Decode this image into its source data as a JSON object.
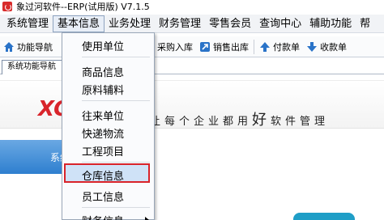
{
  "window": {
    "title": "象过河软件--ERP(试用版) V7.1.5"
  },
  "menubar": {
    "items": [
      "系统管理",
      "基本信息",
      "业务处理",
      "财务管理",
      "零售会员",
      "查询中心",
      "辅助功能",
      "帮"
    ]
  },
  "toolbar": {
    "buttons": [
      {
        "label": "功能导航",
        "icon": "home-icon"
      },
      {
        "label": "采购入库",
        "icon": "purchase-in-icon"
      },
      {
        "label": "销售出库",
        "icon": "sales-out-icon"
      },
      {
        "label": "付款单",
        "icon": "payment-icon"
      },
      {
        "label": "收款单",
        "icon": "receipt-icon"
      }
    ]
  },
  "tabs": {
    "active": "系统功能导航"
  },
  "banner": {
    "logo": "XC",
    "slogan_pre": "让每个企业都用",
    "slogan_big": "好",
    "slogan_post": "软件管理"
  },
  "panel": {
    "label": "系统"
  },
  "dropdown": {
    "items": [
      "使用单位",
      "商品信息",
      "原料辅料",
      "往来单位",
      "快递物流",
      "工程项目",
      "仓库信息",
      "员工信息",
      "财务信息"
    ],
    "highlighted": "仓库信息"
  },
  "colors": {
    "accent_red": "#d9232a",
    "highlight": "#cfe2f7",
    "panel_blue": "#2e7fcf"
  }
}
